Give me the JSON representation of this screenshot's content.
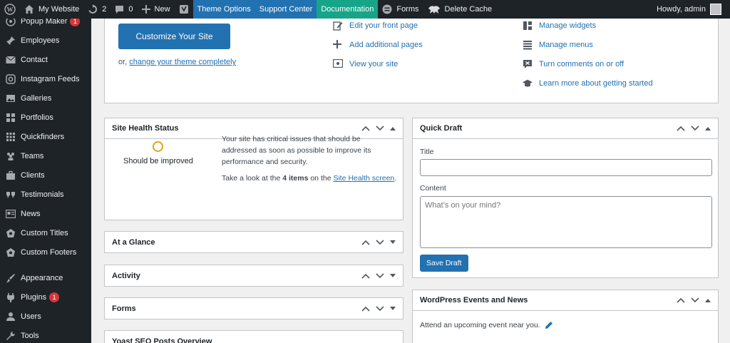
{
  "adminbar": {
    "site_name": "My Website",
    "updates_count": "2",
    "comments_count": "0",
    "new_label": "New",
    "theme_options": "Theme Options",
    "support_center": "Support Center",
    "documentation": "Documentation",
    "forms": "Forms",
    "delete_cache": "Delete Cache",
    "howdy": "Howdy, admin",
    "colors": {
      "theme_options_bg": "#2271b1",
      "support_center_bg": "#2271b1",
      "documentation_bg": "#17a589"
    }
  },
  "sidebar": {
    "items": [
      {
        "label": "Popup Maker",
        "badge": "1",
        "icon": "popup-icon"
      },
      {
        "label": "Employees",
        "icon": "pin-icon"
      },
      {
        "label": "Contact",
        "icon": "mail-icon"
      },
      {
        "label": "Instagram Feeds",
        "icon": "instagram-icon"
      },
      {
        "label": "Galleries",
        "icon": "gallery-icon"
      },
      {
        "label": "Portfolios",
        "icon": "portfolio-icon"
      },
      {
        "label": "Quickfinders",
        "icon": "grid-icon"
      },
      {
        "label": "Teams",
        "icon": "groups-icon"
      },
      {
        "label": "Clients",
        "icon": "briefcase-icon"
      },
      {
        "label": "Testimonials",
        "icon": "quote-icon"
      },
      {
        "label": "News",
        "icon": "news-icon"
      },
      {
        "label": "Custom Titles",
        "icon": "admin-icon"
      },
      {
        "label": "Custom Footers",
        "icon": "admin-icon"
      },
      {
        "label": "Appearance",
        "icon": "brush-icon"
      },
      {
        "label": "Plugins",
        "badge": "1",
        "icon": "plugin-icon"
      },
      {
        "label": "Users",
        "icon": "user-icon"
      },
      {
        "label": "Tools",
        "icon": "wrench-icon"
      }
    ]
  },
  "welcome": {
    "customize_button": "Customize Your Site",
    "or_text": "or,",
    "change_theme_link": "change your theme completely",
    "next_steps": [
      "Edit your front page",
      "Add additional pages",
      "View your site"
    ],
    "more_actions": [
      "Manage widgets",
      "Manage menus",
      "Turn comments on or off",
      "Learn more about getting started"
    ]
  },
  "site_health": {
    "title": "Site Health Status",
    "status": "Should be improved",
    "message": "Your site has critical issues that should be addressed as soon as possible to improve its performance and security.",
    "take_look_prefix": "Take a look at the",
    "items_count": "4 items",
    "on_the": "on the",
    "link": "Site Health screen",
    "suffix": "."
  },
  "boxes": {
    "at_a_glance": "At a Glance",
    "activity": "Activity",
    "forms": "Forms",
    "yoast": "Yoast SEO Posts Overview"
  },
  "quick_draft": {
    "title": "Quick Draft",
    "title_label": "Title",
    "title_value": "",
    "content_label": "Content",
    "content_placeholder": "What’s on your mind?",
    "save_button": "Save Draft"
  },
  "events": {
    "title": "WordPress Events and News",
    "attend_text": "Attend an upcoming event near you."
  }
}
